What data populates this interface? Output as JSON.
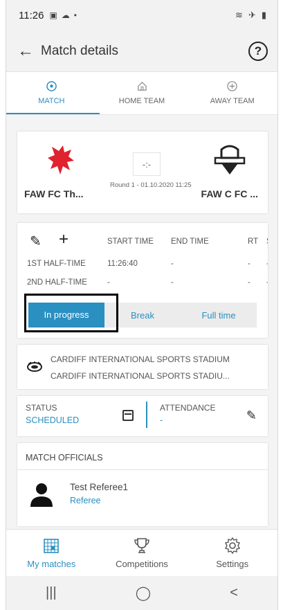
{
  "status_bar": {
    "time": "11:26",
    "icons": [
      "image-icon",
      "cloud-icon",
      "dot"
    ]
  },
  "app_bar": {
    "title": "Match details",
    "back_glyph": "←",
    "help_glyph": "?"
  },
  "tabs": [
    {
      "label": "MATCH",
      "icon": "soccer-ball-icon",
      "active": true
    },
    {
      "label": "HOME TEAM",
      "icon": "home-icon",
      "active": false
    },
    {
      "label": "AWAY TEAM",
      "icon": "plane-icon",
      "active": false
    }
  ],
  "match": {
    "home_team": "FAW FC Th...",
    "away_team": "FAW C FC ...",
    "score": "-:-",
    "round_info": "Round 1 - 01.10.2020 11:25"
  },
  "periods": {
    "headers": [
      "START TIME",
      "END TIME",
      "RT",
      "S T"
    ],
    "rows": [
      {
        "name": "1ST HALF-TIME",
        "start": "11:26:40",
        "end": "-",
        "rt": "-",
        "st": "-"
      },
      {
        "name": "2ND HALF-TIME",
        "start": "-",
        "end": "-",
        "rt": "-",
        "st": "-"
      }
    ],
    "buttons": [
      "In progress",
      "Break",
      "Full time"
    ],
    "active_button": "In progress"
  },
  "stadium": {
    "line1": "CARDIFF INTERNATIONAL SPORTS STADIUM",
    "line2": "CARDIFF INTERNATIONAL SPORTS STADIU..."
  },
  "status": {
    "label": "STATUS",
    "value": "SCHEDULED"
  },
  "attendance": {
    "label": "ATTENDANCE",
    "value": "-"
  },
  "officials": {
    "title": "MATCH OFFICIALS",
    "items": [
      {
        "name": "Test Referee1",
        "role": "Referee"
      }
    ]
  },
  "bottom_nav": [
    {
      "label": "My matches",
      "icon": "calendar-grid-icon",
      "active": true
    },
    {
      "label": "Competitions",
      "icon": "trophy-icon",
      "active": false
    },
    {
      "label": "Settings",
      "icon": "gear-icon",
      "active": false
    }
  ],
  "system_nav": {
    "recent": "|||",
    "home": "◯",
    "back": "<"
  },
  "colors": {
    "accent": "#2a8fc1",
    "background": "#f4f4f4",
    "crest_red": "#e0212e"
  }
}
